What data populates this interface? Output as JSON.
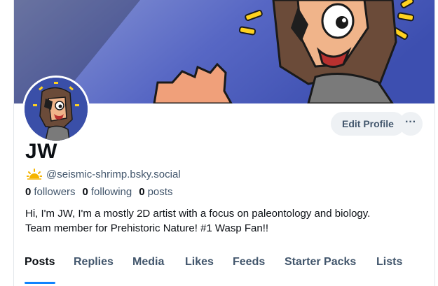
{
  "profile": {
    "display_name": "JW",
    "handle": "@seismic-shrimp.bsky.social",
    "bio_line1": "Hi, I'm JW, I'm a mostly 2D artist with a focus on paleontology and biology.",
    "bio_line2": "Team member for Prehistoric Nature! #1 Wasp Fan!!"
  },
  "stats": {
    "followers_count": "0",
    "followers_label": "followers",
    "following_count": "0",
    "following_label": "following",
    "posts_count": "0",
    "posts_label": "posts"
  },
  "actions": {
    "edit_profile_label": "Edit Profile",
    "more_label": "···"
  },
  "tabs": [
    {
      "label": "Posts",
      "active": true
    },
    {
      "label": "Replies"
    },
    {
      "label": "Media"
    },
    {
      "label": "Likes"
    },
    {
      "label": "Feeds"
    },
    {
      "label": "Starter Packs"
    },
    {
      "label": "Lists"
    }
  ],
  "icons": {
    "handle_badge": "sun-icon",
    "more": "ellipsis-icon"
  },
  "colors": {
    "accent": "#1083fe",
    "banner_bg": "#4a5fc0",
    "muted_text": "#42566c"
  }
}
